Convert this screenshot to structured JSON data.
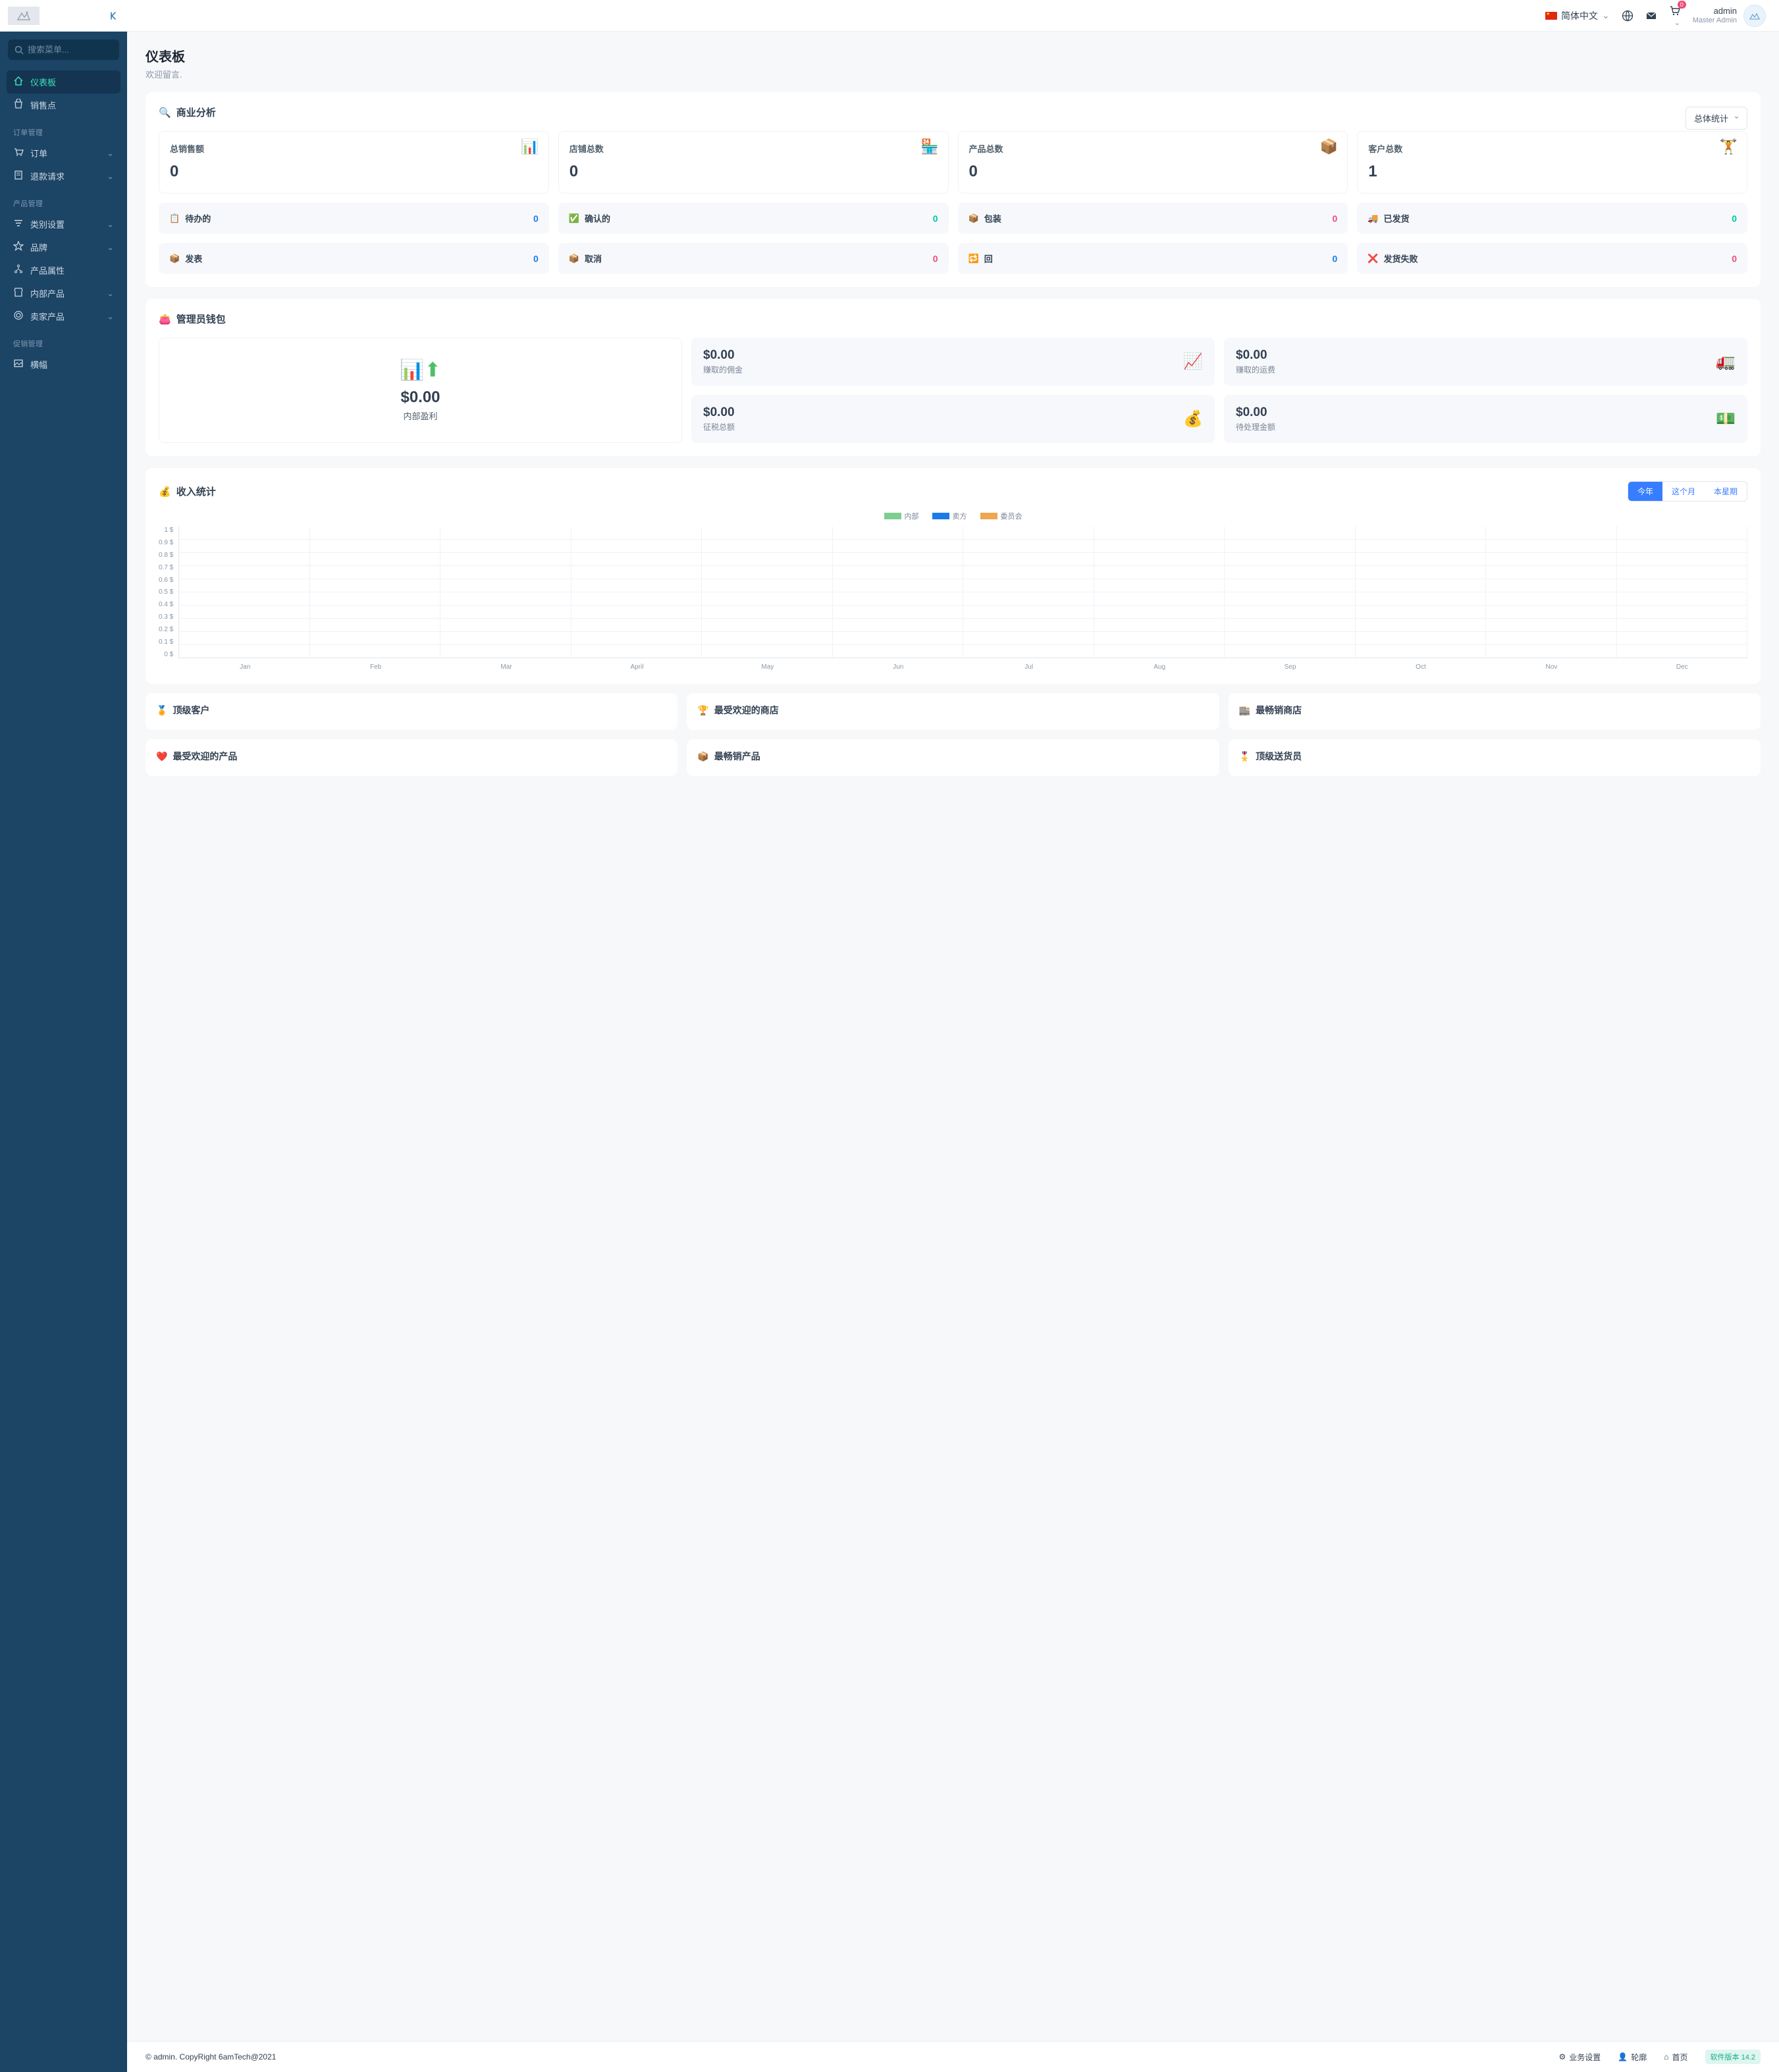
{
  "header": {
    "language": "简体中文",
    "cart_badge": "0",
    "user_name": "admin",
    "user_role": "Master Admin"
  },
  "sidebar": {
    "search_placeholder": "搜索菜单...",
    "items": {
      "dashboard": "仪表板",
      "pos": "销售点"
    },
    "sections": {
      "order_mgmt": "订单管理",
      "product_mgmt": "产品管理",
      "promo_mgmt": "促销管理"
    },
    "order_items": {
      "orders": "订单",
      "refund": "退款请求"
    },
    "product_items": {
      "category": "类别设置",
      "brand": "品牌",
      "attr": "产品属性",
      "inhouse": "内部产品",
      "seller": "卖家产品"
    },
    "promo_items": {
      "banner": "横幅"
    }
  },
  "page": {
    "title": "仪表板",
    "subtitle": "欢迎留言."
  },
  "analytics": {
    "title": "商业分析",
    "filter": "总体统计",
    "big": [
      {
        "label": "总销售额",
        "value": "0",
        "icon": "📊"
      },
      {
        "label": "店铺总数",
        "value": "0",
        "icon": "🏪"
      },
      {
        "label": "产品总数",
        "value": "0",
        "icon": "📦"
      },
      {
        "label": "客户总数",
        "value": "1",
        "icon": "🏋️"
      }
    ],
    "small1": [
      {
        "icon": "📋",
        "label": "待办的",
        "value": "0",
        "cls": "blue"
      },
      {
        "icon": "✅",
        "label": "确认的",
        "value": "0",
        "cls": "green"
      },
      {
        "icon": "📦",
        "label": "包装",
        "value": "0",
        "cls": "red"
      },
      {
        "icon": "🚚",
        "label": "已发货",
        "value": "0",
        "cls": "green"
      }
    ],
    "small2": [
      {
        "icon": "📦",
        "label": "发表",
        "value": "0",
        "cls": "blue"
      },
      {
        "icon": "📦",
        "label": "取消",
        "value": "0",
        "cls": "red"
      },
      {
        "icon": "🔁",
        "label": "回",
        "value": "0",
        "cls": "blue"
      },
      {
        "icon": "❌",
        "label": "发货失败",
        "value": "0",
        "cls": "red"
      }
    ]
  },
  "wallet": {
    "title": "管理员钱包",
    "big": {
      "amount": "$0.00",
      "label": "内部盈利"
    },
    "cells": [
      {
        "amount": "$0.00",
        "label": "赚取的佣金",
        "icon": "📈"
      },
      {
        "amount": "$0.00",
        "label": "赚取的运费",
        "icon": "🚛"
      },
      {
        "amount": "$0.00",
        "label": "征税总额",
        "icon": "💰"
      },
      {
        "amount": "$0.00",
        "label": "待处理金额",
        "icon": "💵"
      }
    ]
  },
  "earnings": {
    "title": "收入统计",
    "tabs": {
      "year": "今年",
      "month": "这个月",
      "week": "本星期"
    },
    "legend": {
      "inhouse": "内部",
      "seller": "卖方",
      "commission": "委员会"
    }
  },
  "chart_data": {
    "type": "line",
    "title": "收入统计",
    "xlabel": "",
    "ylabel": "$",
    "ylim": [
      0,
      1
    ],
    "y_ticks": [
      "1 $",
      "0.9 $",
      "0.8 $",
      "0.7 $",
      "0.6 $",
      "0.5 $",
      "0.4 $",
      "0.3 $",
      "0.2 $",
      "0.1 $",
      "0 $"
    ],
    "categories": [
      "Jan",
      "Feb",
      "Mar",
      "April",
      "May",
      "Jun",
      "Jul",
      "Aug",
      "Sep",
      "Oct",
      "Nov",
      "Dec"
    ],
    "series": [
      {
        "name": "内部",
        "color": "#7ece8f",
        "values": [
          0,
          0,
          0,
          0,
          0,
          0,
          0,
          0,
          0,
          0,
          0,
          0
        ]
      },
      {
        "name": "卖方",
        "color": "#1b7bea",
        "values": [
          0,
          0,
          0,
          0,
          0,
          0,
          0,
          0,
          0,
          0,
          0,
          0
        ]
      },
      {
        "name": "委员会",
        "color": "#f0a64e",
        "values": [
          0,
          0,
          0,
          0,
          0,
          0,
          0,
          0,
          0,
          0,
          0,
          0
        ]
      }
    ]
  },
  "panels": {
    "top_customer": "顶级客户",
    "pop_store": "最受欢迎的商店",
    "top_selling_store": "最畅销商店",
    "pop_product": "最受欢迎的产品",
    "top_selling_product": "最畅销产品",
    "top_delivery": "顶级送货员"
  },
  "footer": {
    "copyright": "© admin. CopyRight 6amTech@2021",
    "biz_settings": "业务设置",
    "profile": "轮廓",
    "home": "首页",
    "version": "软件版本 14.2"
  }
}
